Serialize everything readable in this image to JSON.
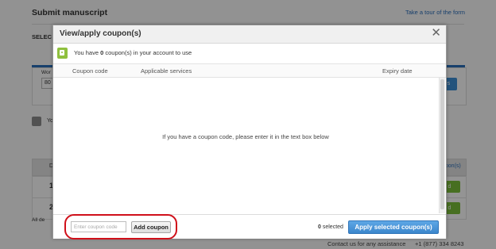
{
  "background": {
    "title": "Submit manuscript",
    "tour_link": "Take a tour of the form",
    "select_label": "SELEC",
    "word_label": "Wor",
    "word_value": "80",
    "blue_button": "es",
    "you_text": "Yo",
    "table_head_col": "D",
    "coupon_head": "upon(s)",
    "row1_num": "1",
    "row2_num": "2",
    "row1_action": "d",
    "row2_action": "d",
    "all_text": "All de",
    "contact_text": "Contact us for any assistance",
    "phone": "+1 (877) 334 8243"
  },
  "dialog": {
    "title": "View/apply coupon(s)",
    "close_glyph": "✕",
    "info_prefix": "You have ",
    "info_count": "0",
    "info_suffix": " coupon(s) in your account to use",
    "columns": {
      "code": "Coupon code",
      "services": "Applicable services",
      "expiry": "Expiry date"
    },
    "empty_message": "If you have a coupon code, please enter it in the text box below",
    "coupon_input": {
      "placeholder": "Enter coupon code",
      "value": ""
    },
    "add_button": "Add coupon",
    "selected_count": "0",
    "selected_label": " selected",
    "apply_button": "Apply selected coupon(s)"
  },
  "colors": {
    "accent_blue": "#3b86cc",
    "info_green": "#8fc03e",
    "highlight_red": "#d0101a"
  },
  "icons": {
    "info": "coupon-tag-icon",
    "close": "close-icon",
    "phone": "phone-icon"
  }
}
